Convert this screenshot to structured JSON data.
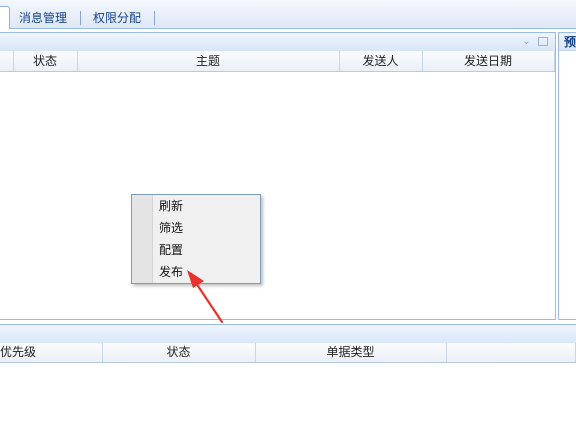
{
  "tabs": [
    {
      "label": "消息管理"
    },
    {
      "label": "权限分配"
    }
  ],
  "grid": {
    "columns": [
      "状态",
      "主题",
      "发送人",
      "发送日期"
    ]
  },
  "preview": {
    "title": "预"
  },
  "bottom_grid": {
    "columns": [
      "优先级",
      "状态",
      "单据类型"
    ]
  },
  "context_menu": {
    "items": [
      "刷新",
      "筛选",
      "配置",
      "发布"
    ]
  },
  "colors": {
    "panel_border": "#99bbe8",
    "tab_text": "#15428b",
    "annotation_arrow": "#e8322d"
  }
}
